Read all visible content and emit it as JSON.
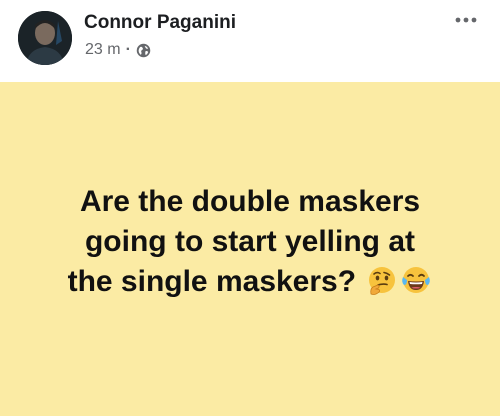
{
  "post": {
    "author": "Connor Paganini",
    "timestamp": "23 m",
    "separator": "·",
    "audience_icon": "globe-icon",
    "more_icon": "more-options-icon",
    "background_color": "#fbeba4",
    "text_lines": [
      "Are the double maskers",
      "going to start yelling at",
      "the single maskers?"
    ],
    "emojis": [
      "thinking-face-icon",
      "tears-of-joy-icon"
    ]
  }
}
